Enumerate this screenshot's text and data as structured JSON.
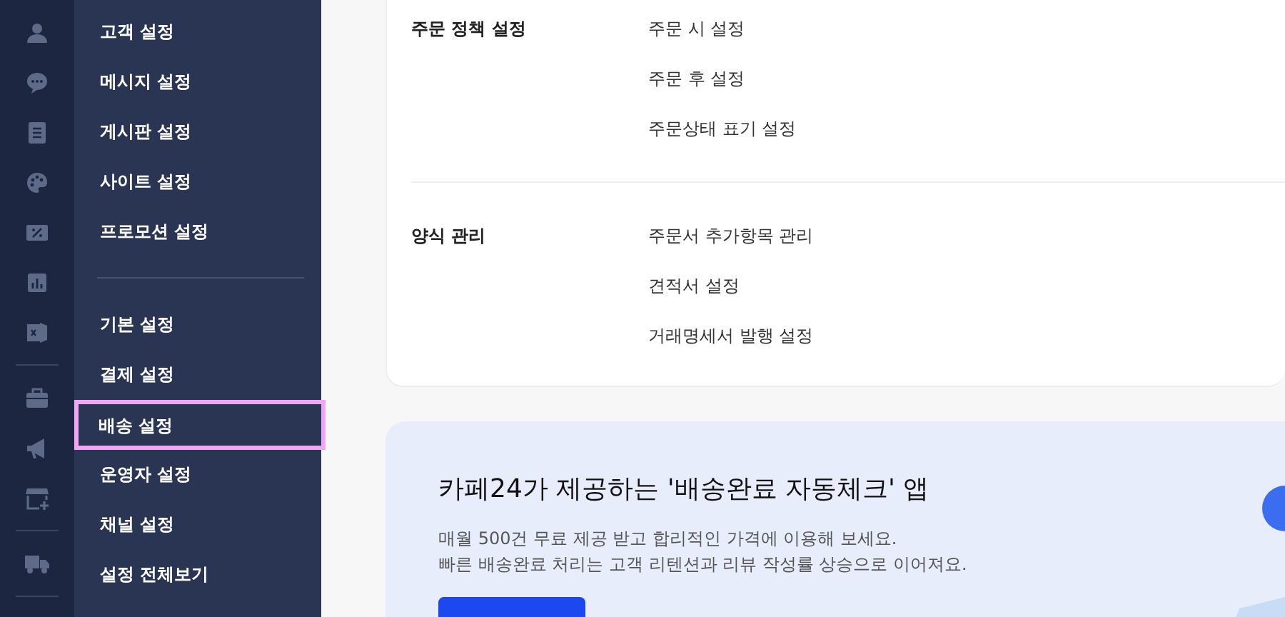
{
  "icon_rail": [
    {
      "icons": [
        {
          "kind": "person"
        },
        {
          "kind": "chat"
        },
        {
          "kind": "document"
        },
        {
          "kind": "palette"
        },
        {
          "kind": "ticket"
        },
        {
          "kind": "chart"
        },
        {
          "kind": "door"
        }
      ]
    },
    {
      "icons": [
        {
          "kind": "briefcase"
        },
        {
          "kind": "megaphone"
        },
        {
          "kind": "store"
        }
      ]
    },
    {
      "icons": [
        {
          "kind": "truck"
        }
      ]
    }
  ],
  "menu_groups": [
    {
      "items": [
        {
          "label": "고객 설정",
          "selected": false
        },
        {
          "label": "메시지 설정",
          "selected": false
        },
        {
          "label": "게시판 설정",
          "selected": false
        },
        {
          "label": "사이트 설정",
          "selected": false
        },
        {
          "label": "프로모션 설정",
          "selected": false
        }
      ]
    },
    {
      "items": [
        {
          "label": "기본 설정",
          "selected": false
        },
        {
          "label": "결제 설정",
          "selected": false
        },
        {
          "label": "배송 설정",
          "selected": true
        },
        {
          "label": "운영자 설정",
          "selected": false
        },
        {
          "label": "채널 설정",
          "selected": false
        },
        {
          "label": "설정 전체보기",
          "selected": false
        }
      ]
    }
  ],
  "settings_sections": [
    {
      "heading": "주문 정책 설정",
      "links": [
        "주문 시 설정",
        "주문 후 설정",
        "주문상태 표기 설정"
      ]
    },
    {
      "heading": "양식 관리",
      "links": [
        "주문서 추가항목 관리",
        "견적서 설정",
        "거래명세서 발행 설정"
      ]
    }
  ],
  "promo": {
    "title": "카페24가 제공하는 '배송완료 자동체크' 앱",
    "lines": [
      "매월 500건 무료 제공 받고 합리적인 가격에 이용해 보세요.",
      "빠른 배송완료 처리는 고객 리텐션과 리뷰 작성률 상승으로 이어져요."
    ]
  }
}
